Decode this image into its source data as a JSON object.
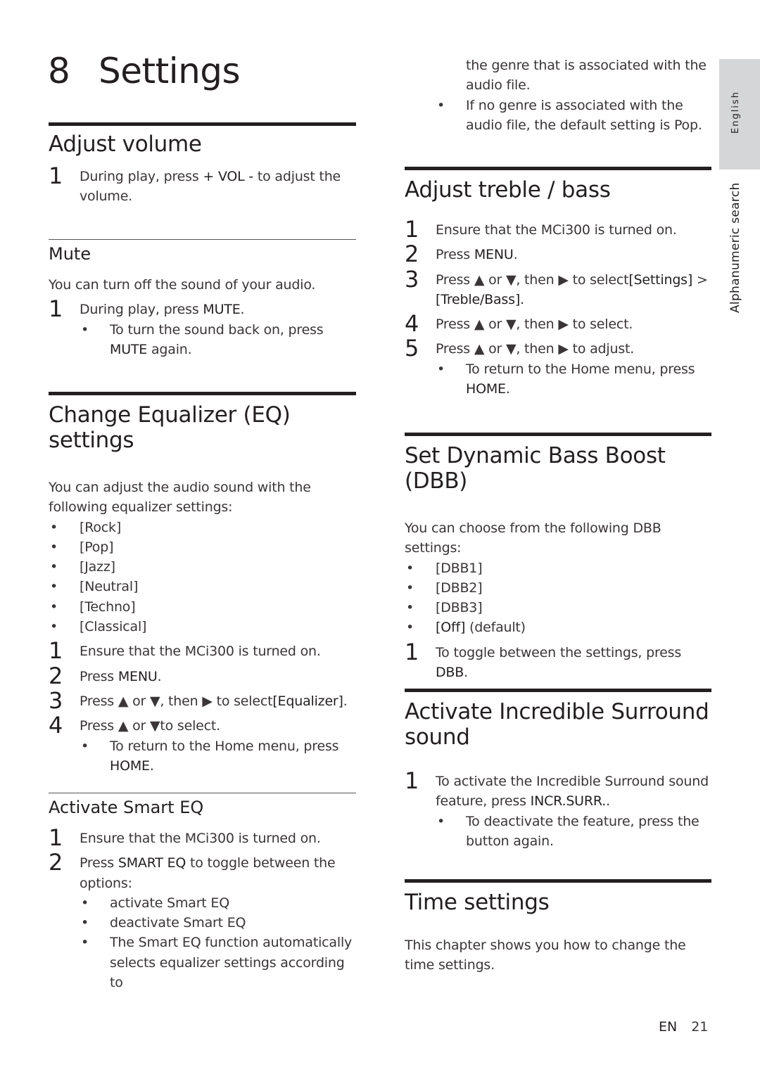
{
  "chapter": {
    "number": "8",
    "title": "Settings"
  },
  "side_tabs": {
    "language": "English",
    "section": "Alphanumeric search"
  },
  "footer": {
    "lang": "EN",
    "page": "21"
  },
  "adjust_volume": {
    "title": "Adjust volume",
    "steps": [
      {
        "n": "1",
        "pre": "During play, press ",
        "kw": "+ VOL -",
        "post": " to adjust the volume."
      }
    ]
  },
  "mute": {
    "title": "Mute",
    "intro": "You can turn off the sound of your audio.",
    "step": {
      "n": "1",
      "pre": "During play, press ",
      "kw": "MUTE",
      "post": "."
    },
    "bullet": {
      "pre": "To turn the sound back on, press ",
      "kw": "MUTE",
      "post": " again."
    }
  },
  "eq": {
    "title": "Change Equalizer (EQ) settings",
    "intro": "You can adjust the audio sound with the following equalizer settings:",
    "options": [
      "[Rock]",
      "[Pop]",
      "[Jazz]",
      "[Neutral]",
      "[Techno]",
      "[Classical]"
    ],
    "steps": [
      {
        "n": "1",
        "text": "Ensure that the MCi300 is turned on."
      },
      {
        "n": "2",
        "pre": "Press ",
        "kw": "MENU",
        "post": "."
      },
      {
        "n": "3",
        "pre": "Press ▲ or ▼, then ▶ to select",
        "kw": "[Equalizer]",
        "post": "."
      },
      {
        "n": "4",
        "text": "Press ▲ or ▼to select."
      }
    ],
    "bullet": {
      "pre": "To return to the Home menu, press ",
      "kw": "HOME",
      "post": "."
    }
  },
  "smart_eq": {
    "title": "Activate Smart EQ",
    "steps": [
      {
        "n": "1",
        "text": "Ensure that the MCi300 is turned on."
      },
      {
        "n": "2",
        "pre": "Press ",
        "kw": "SMART EQ",
        "post": " to toggle between the options:"
      }
    ],
    "bullets": [
      "activate Smart EQ",
      "deactivate Smart EQ",
      "The Smart EQ function automatically selects equalizer settings according to"
    ]
  },
  "smart_eq_cont": {
    "continuation": "the genre that is associated with the audio file.",
    "bullet": "If no genre is associated with the audio file, the default setting is Pop."
  },
  "treble_bass": {
    "title": "Adjust treble / bass",
    "steps": [
      {
        "n": "1",
        "text": "Ensure that the MCi300 is turned on."
      },
      {
        "n": "2",
        "pre": "Press ",
        "kw": "MENU",
        "post": "."
      },
      {
        "n": "3",
        "pre": "Press ▲ or ▼, then ▶ to select",
        "kw": "[Settings]",
        "mid": " > ",
        "kw2": "[Treble/Bass]",
        "post": "."
      },
      {
        "n": "4",
        "text": "Press ▲ or ▼, then ▶ to select."
      },
      {
        "n": "5",
        "text": "Press ▲ or ▼, then ▶ to adjust."
      }
    ],
    "bullet": {
      "pre": "To return to the Home menu, press ",
      "kw": "HOME",
      "post": "."
    }
  },
  "dbb": {
    "title": "Set Dynamic Bass Boost (DBB)",
    "intro": "You can choose from the following DBB settings:",
    "options": [
      "[DBB1]",
      "[DBB2]",
      "[DBB3]"
    ],
    "off_option": {
      "kw": "[Off]",
      "post": " (default)"
    },
    "step": {
      "n": "1",
      "pre": "To toggle between the settings, press ",
      "kw": "DBB",
      "post": "."
    }
  },
  "surround": {
    "title": "Activate Incredible Surround sound",
    "step": {
      "n": "1",
      "pre": "To activate the Incredible Surround sound feature, press ",
      "kw": "INCR.SURR.",
      "post": "."
    },
    "bullet": "To deactivate the feature, press the button again."
  },
  "time": {
    "title": "Time settings",
    "intro": "This chapter shows you how to change the time settings."
  },
  "bullet_glyph": "•"
}
